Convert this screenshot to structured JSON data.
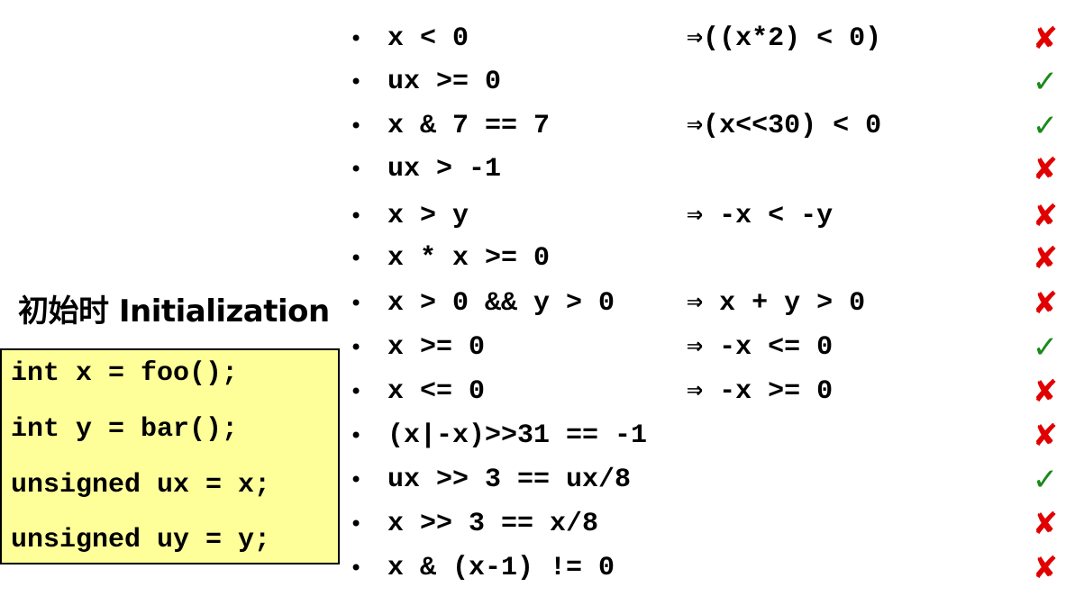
{
  "title": "初始时 Initialization",
  "initialization": [
    "int x = foo();",
    "int y = bar();",
    "unsigned ux = x;",
    "unsigned uy = y;"
  ],
  "bullet_glyph": "•",
  "marks": {
    "true": {
      "symbol": "✓",
      "icon": "check-icon",
      "color": "#1a8a1a"
    },
    "false": {
      "symbol": "✘",
      "icon": "cross-icon",
      "color": "#e00000"
    }
  },
  "items": [
    {
      "expr": "x < 0",
      "consequence": "⇒((x*2) < 0)",
      "result": false
    },
    {
      "expr": "ux >= 0",
      "consequence": "",
      "result": true
    },
    {
      "expr": "x & 7 == 7",
      "consequence": "⇒(x<<30) < 0",
      "result": true
    },
    {
      "expr": "ux > -1",
      "consequence": "",
      "result": false
    },
    {
      "expr": "x > y",
      "consequence": "⇒ -x < -y",
      "result": false
    },
    {
      "expr": "x * x >= 0",
      "consequence": "",
      "result": false
    },
    {
      "expr": "x > 0 && y > 0",
      "consequence": "⇒ x + y > 0",
      "result": false
    },
    {
      "expr": "x >= 0",
      "consequence": "⇒ -x <= 0",
      "result": true
    },
    {
      "expr": "x <= 0",
      "consequence": "⇒ -x >= 0",
      "result": false
    },
    {
      "expr": "(x|-x)>>31 == -1",
      "consequence": "",
      "result": false
    },
    {
      "expr": "ux >> 3 == ux/8",
      "consequence": "",
      "result": true
    },
    {
      "expr": "x >> 3 == x/8",
      "consequence": "",
      "result": false
    },
    {
      "expr": "x & (x-1) != 0",
      "consequence": "",
      "result": false
    }
  ]
}
